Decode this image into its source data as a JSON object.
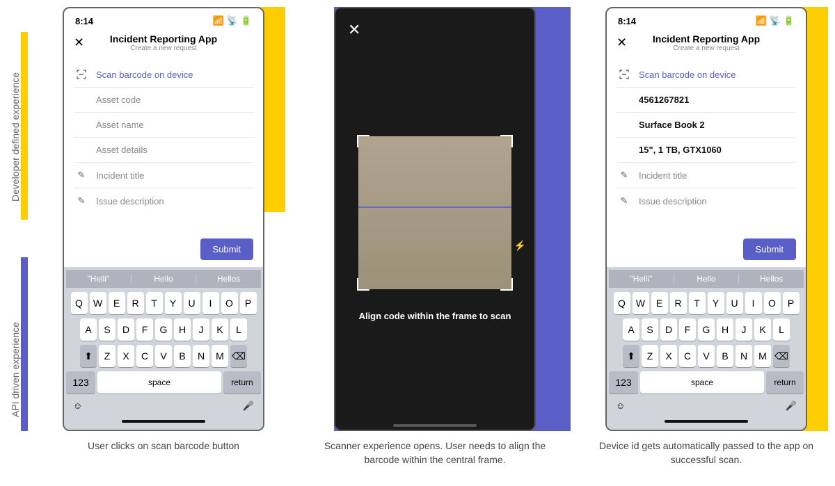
{
  "labels": {
    "dev_experience": "Developer defined experience",
    "api_experience": "API driven experience"
  },
  "colors": {
    "yellow": "#ffce00",
    "purple": "#5a5fc7"
  },
  "statusbar": {
    "time": "8:14"
  },
  "app": {
    "title": "Incident Reporting App",
    "subtitle": "Create a new request",
    "scan_label": "Scan barcode on device",
    "submit": "Submit"
  },
  "fields_empty": {
    "asset_code": "Asset code",
    "asset_name": "Asset name",
    "asset_details": "Asset details",
    "incident_title": "Incident title",
    "issue_desc": "Issue description"
  },
  "fields_filled": {
    "asset_code": "4561267821",
    "asset_name": "Surface Book 2",
    "asset_details": "15\", 1 TB, GTX1060",
    "incident_title": "Incident title",
    "issue_desc": "Issue description"
  },
  "keyboard": {
    "suggestions": [
      "\"Helli\"",
      "Hello",
      "Hellos"
    ],
    "row1": [
      "Q",
      "W",
      "E",
      "R",
      "T",
      "Y",
      "U",
      "I",
      "O",
      "P"
    ],
    "row2": [
      "A",
      "S",
      "D",
      "F",
      "G",
      "H",
      "J",
      "K",
      "L"
    ],
    "row3": [
      "Z",
      "X",
      "C",
      "V",
      "B",
      "N",
      "M"
    ],
    "numkey": "123",
    "space": "space",
    "returnkey": "return"
  },
  "scanner": {
    "instruction": "Align code within the frame to scan"
  },
  "captions": {
    "p1": "User clicks on scan barcode button",
    "p2": "Scanner experience opens. User needs to align the barcode within the central frame.",
    "p3": "Device id gets automatically passed to the app on successful scan."
  }
}
